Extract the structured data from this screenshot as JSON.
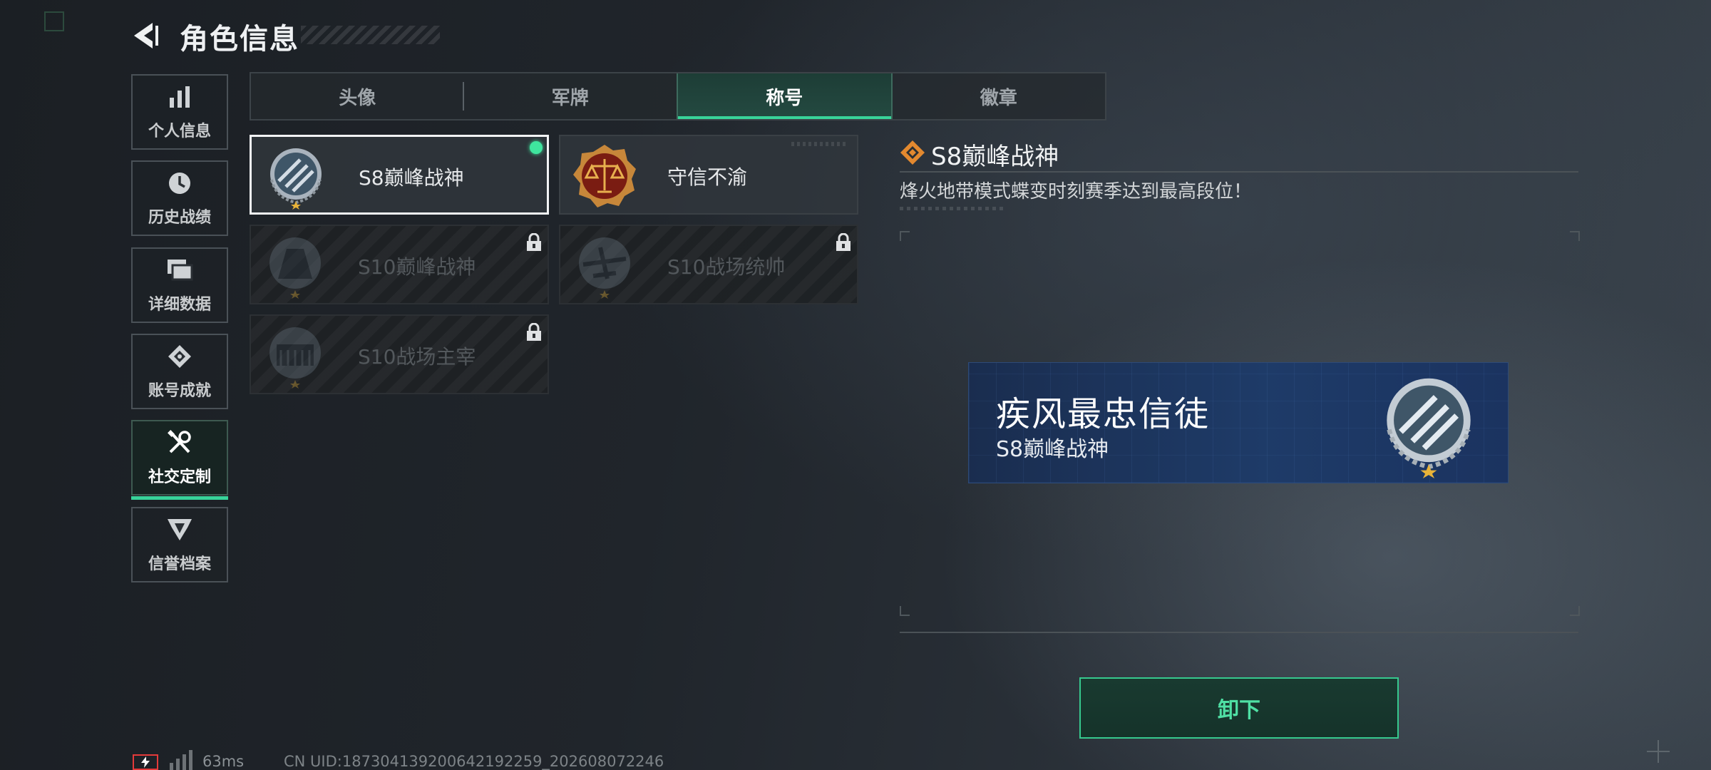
{
  "header": {
    "title": "角色信息",
    "back_icon": "chevron-left-icon"
  },
  "sidebar": {
    "items": [
      {
        "label": "个人信息",
        "icon": "bar-chart-icon",
        "active": false
      },
      {
        "label": "历史战绩",
        "icon": "clock-icon",
        "active": false
      },
      {
        "label": "详细数据",
        "icon": "stacked-cards-icon",
        "active": false
      },
      {
        "label": "账号成就",
        "icon": "badge-icon",
        "active": false
      },
      {
        "label": "社交定制",
        "icon": "tools-icon",
        "active": true
      },
      {
        "label": "信誉档案",
        "icon": "shield-wing-icon",
        "active": false
      }
    ]
  },
  "tabs": [
    {
      "label": "头像",
      "active": false
    },
    {
      "label": "军牌",
      "active": false
    },
    {
      "label": "称号",
      "active": true
    },
    {
      "label": "徽章",
      "active": false
    }
  ],
  "titles": [
    {
      "name": "S8巅峰战神",
      "state": "equipped",
      "emblem": "laurel-emblem-icon"
    },
    {
      "name": "守信不渝",
      "state": "unlocked",
      "emblem": "scales-emblem-icon"
    },
    {
      "name": "S10巅峰战神",
      "state": "locked",
      "emblem": "tower-emblem-icon"
    },
    {
      "name": "S10战场统帅",
      "state": "locked",
      "emblem": "aircraft-emblem-icon"
    },
    {
      "name": "S10战场主宰",
      "state": "locked",
      "emblem": "colosseum-emblem-icon"
    }
  ],
  "detail": {
    "title": "S8巅峰战神",
    "description": "烽火地带模式蝶变时刻赛季达到最高段位！",
    "preview": {
      "player_name": "疾风最忠信徒",
      "title": "S8巅峰战神"
    },
    "action_label": "卸下"
  },
  "status": {
    "latency": "63ms",
    "uid": "CN UID:18730413920064219225​9_202608072246",
    "battery_color": "#e33a3a"
  },
  "colors": {
    "accent": "#38d49a",
    "equipped_dot": "#3fe59e",
    "preview_bg": "#1e3b68"
  }
}
